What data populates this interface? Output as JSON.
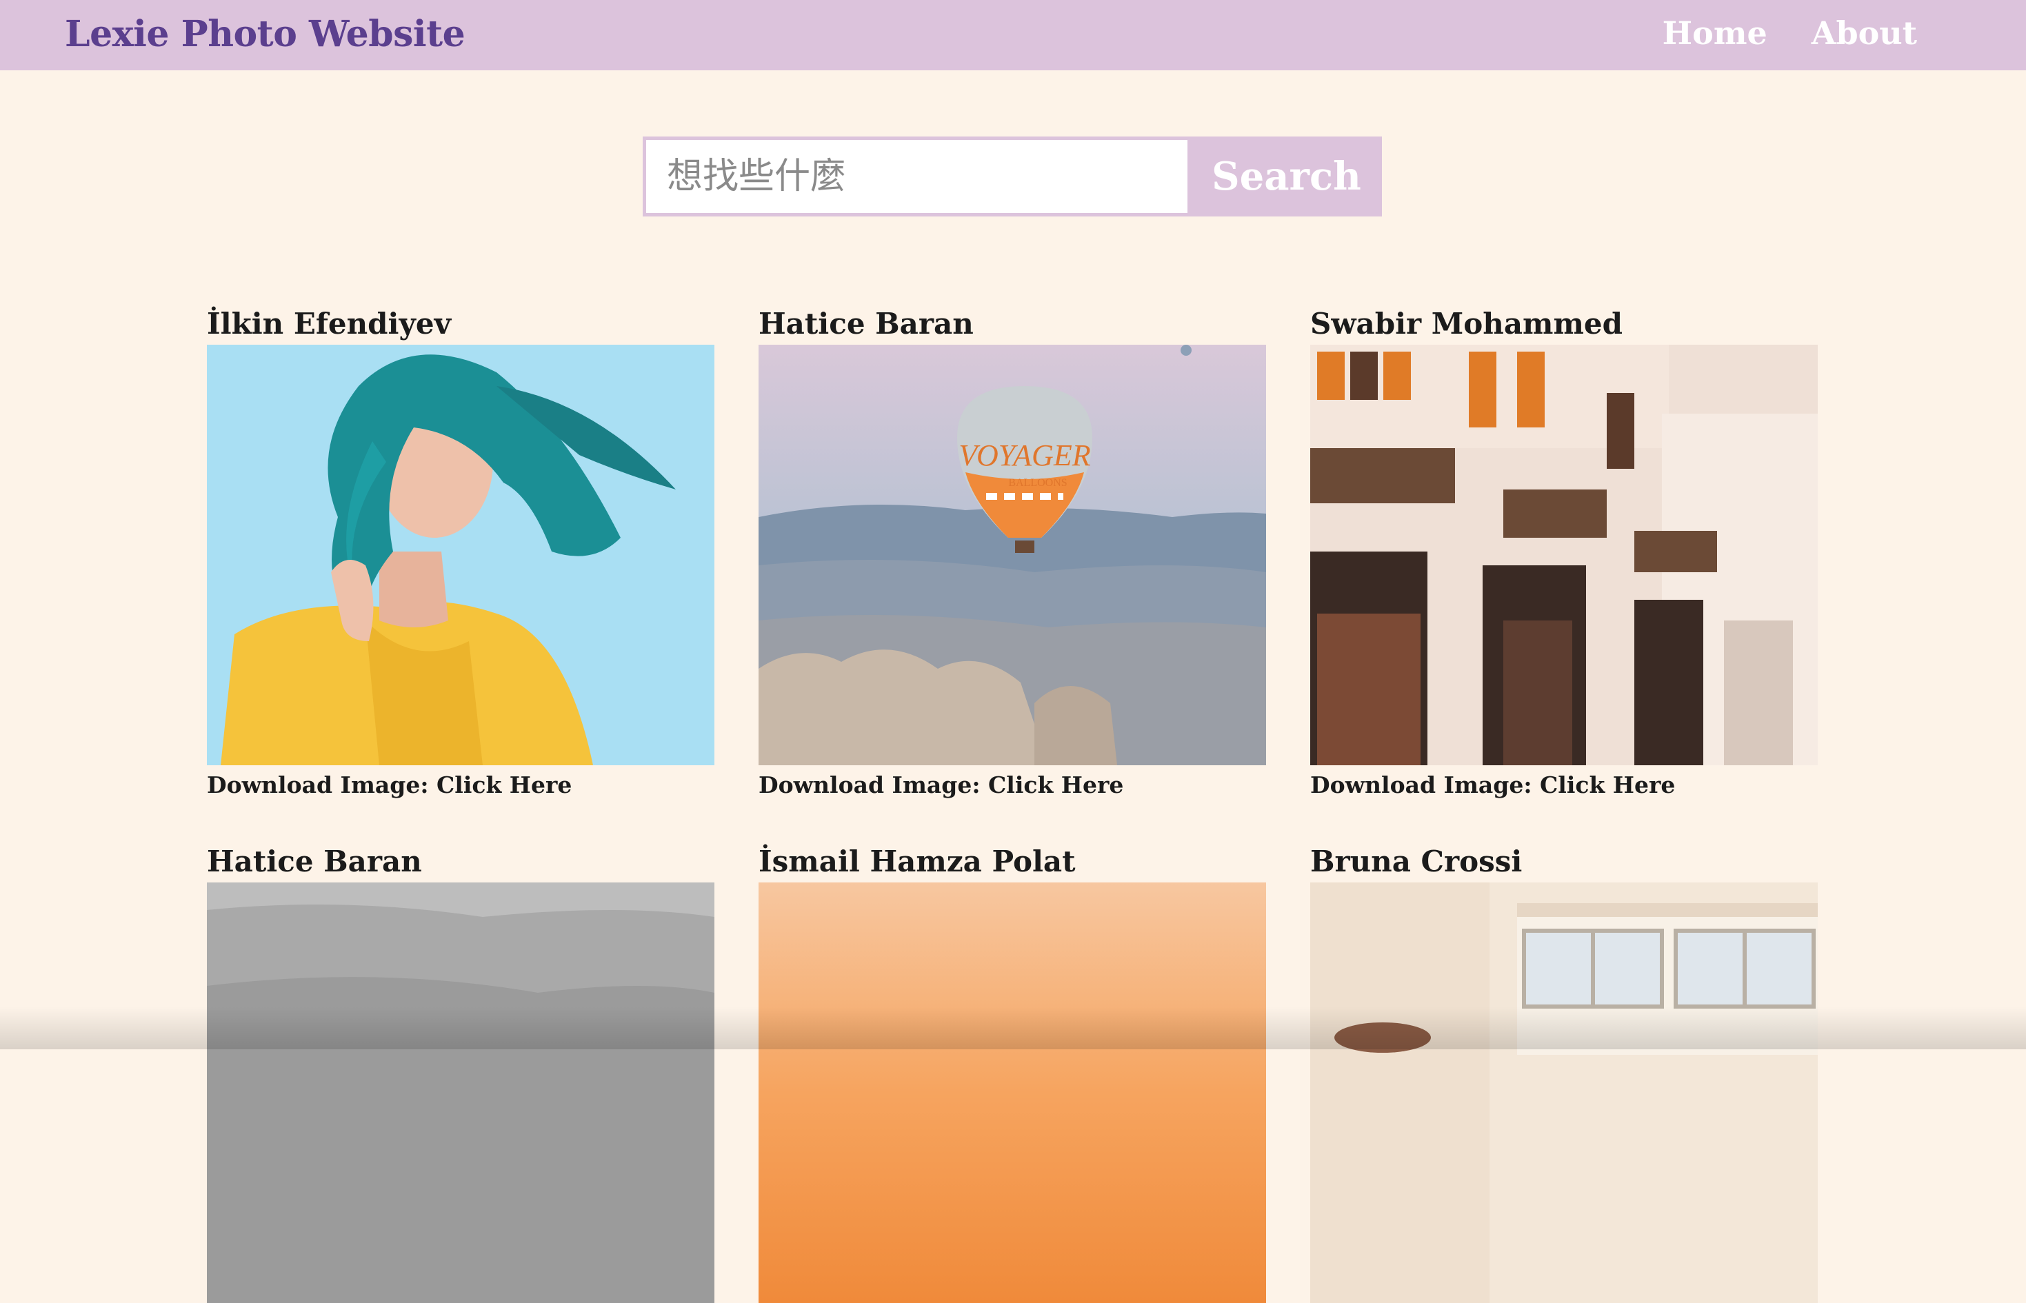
{
  "header": {
    "brand": "Lexie Photo Website",
    "nav": [
      {
        "label": "Home"
      },
      {
        "label": "About"
      }
    ]
  },
  "search": {
    "placeholder": "想找些什麼",
    "value": "",
    "button_label": "Search"
  },
  "photos": [
    {
      "author": "İlkin Efendiyev",
      "download_label": "Download Image:",
      "link_label": "Click Here",
      "subject": "woman-with-teal-hair"
    },
    {
      "author": "Hatice Baran",
      "download_label": "Download Image:",
      "link_label": "Click Here",
      "subject": "hot-air-balloon",
      "balloon_text": "VOYAGER",
      "balloon_subtext": "BALLOONS"
    },
    {
      "author": "Swabir Mohammed",
      "download_label": "Download Image:",
      "link_label": "Click Here",
      "subject": "building-facade"
    },
    {
      "author": "Hatice Baran",
      "subject": "grey-hills"
    },
    {
      "author": "İsmail Hamza Polat",
      "subject": "orange-sky"
    },
    {
      "author": "Bruna Crossi",
      "subject": "bright-room"
    }
  ],
  "colors": {
    "nav_background": "#dcc3dc",
    "brand": "#5b3f8e",
    "page_background": "#fdf3e8"
  }
}
